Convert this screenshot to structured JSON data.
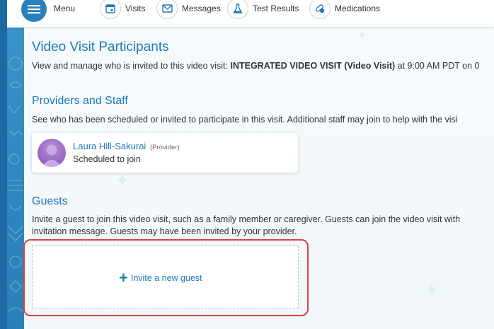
{
  "nav": {
    "menu_label": "Menu",
    "items": [
      {
        "label": "Visits",
        "icon": "calendar-icon"
      },
      {
        "label": "Messages",
        "icon": "envelope-icon"
      },
      {
        "label": "Test Results",
        "icon": "flask-icon"
      },
      {
        "label": "Medications",
        "icon": "pills-icon"
      }
    ]
  },
  "page": {
    "title": "Video Visit Participants",
    "intro_prefix": "View and manage who is invited to this video visit: ",
    "intro_visit_name": "INTEGRATED VIDEO VISIT (",
    "intro_visit_type": "Video Visit",
    "intro_close_paren": ")",
    "intro_suffix": " at 9:00 AM PDT on 0"
  },
  "providers": {
    "heading": "Providers and Staff",
    "description": "See who has been scheduled or invited to participate in this visit. Additional staff may join to help with the visi",
    "participants": [
      {
        "name": "Laura Hill-Sakurai",
        "role": "(Provider)",
        "status": "Scheduled to join"
      }
    ]
  },
  "guests": {
    "heading": "Guests",
    "description_line1": "Invite a guest to join this video visit, such as a family member or caregiver. Guests can join the video visit with",
    "description_line2": "invitation message. Guests may have been invited by your provider.",
    "invite_button": "Invite a new guest"
  },
  "colors": {
    "accent": "#1f7ab5",
    "highlight": "#e0403f",
    "nav_menu": "#2a7fbd"
  }
}
